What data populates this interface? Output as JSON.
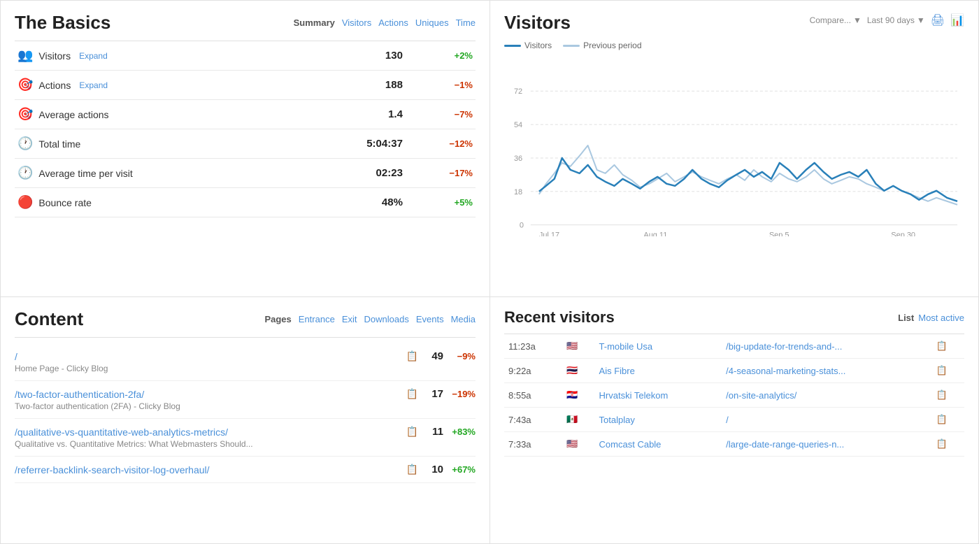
{
  "basics": {
    "title": "The Basics",
    "tabs": [
      {
        "label": "Summary",
        "active": true
      },
      {
        "label": "Visitors"
      },
      {
        "label": "Actions"
      },
      {
        "label": "Uniques"
      },
      {
        "label": "Time"
      }
    ],
    "metrics": [
      {
        "icon": "👥",
        "label": "Visitors",
        "hasExpand": true,
        "value": "130",
        "change": "+2%",
        "changeType": "pos"
      },
      {
        "icon": "🎯",
        "label": "Actions",
        "hasExpand": true,
        "value": "188",
        "change": "−1%",
        "changeType": "neg"
      },
      {
        "icon": "🎯",
        "label": "Average actions",
        "hasExpand": false,
        "value": "1.4",
        "change": "−7%",
        "changeType": "neg"
      },
      {
        "icon": "🕐",
        "label": "Total time",
        "hasExpand": false,
        "value": "5:04:37",
        "change": "−12%",
        "changeType": "neg"
      },
      {
        "icon": "🕐",
        "label": "Average time per visit",
        "hasExpand": false,
        "value": "02:23",
        "change": "−17%",
        "changeType": "neg"
      },
      {
        "icon": "🔴",
        "label": "Bounce rate",
        "hasExpand": false,
        "value": "48%",
        "change": "+5%",
        "changeType": "pos"
      }
    ]
  },
  "visitors_chart": {
    "title": "Visitors",
    "compare_label": "Compare...",
    "range_label": "Last 90 days",
    "legend": {
      "primary": "Visitors",
      "secondary": "Previous period"
    },
    "x_labels": [
      "Jul 17",
      "Aug 11",
      "Sep 5",
      "Sep 30"
    ],
    "y_labels": [
      "0",
      "18",
      "36",
      "54",
      "72"
    ]
  },
  "content": {
    "title": "Content",
    "tabs": [
      {
        "label": "Pages",
        "active": true
      },
      {
        "label": "Entrance"
      },
      {
        "label": "Exit"
      },
      {
        "label": "Downloads"
      },
      {
        "label": "Events"
      },
      {
        "label": "Media"
      }
    ],
    "items": [
      {
        "url": "/",
        "subtitle": "Home Page - Clicky Blog",
        "count": "49",
        "change": "−9%",
        "changeType": "neg"
      },
      {
        "url": "/two-factor-authentication-2fa/",
        "subtitle": "Two-factor authentication (2FA) - Clicky Blog",
        "count": "17",
        "change": "−19%",
        "changeType": "neg"
      },
      {
        "url": "/qualitative-vs-quantitative-web-analytics-metrics/",
        "subtitle": "Qualitative vs. Quantitative Metrics: What Webmasters Should...",
        "count": "11",
        "change": "+83%",
        "changeType": "pos"
      },
      {
        "url": "/referrer-backlink-search-visitor-log-overhaul/",
        "subtitle": "",
        "count": "10",
        "change": "+67%",
        "changeType": "pos"
      }
    ]
  },
  "recent_visitors": {
    "title": "Recent visitors",
    "tabs": [
      {
        "label": "List",
        "active": true
      },
      {
        "label": "Most active"
      }
    ],
    "visitors": [
      {
        "time": "11:23a",
        "flag": "🇺🇸",
        "name": "T-mobile Usa",
        "page": "/big-update-for-trends-and-..."
      },
      {
        "time": "9:22a",
        "flag": "🇹🇭",
        "name": "Ais Fibre",
        "page": "/4-seasonal-marketing-stats..."
      },
      {
        "time": "8:55a",
        "flag": "🇭🇷",
        "name": "Hrvatski Telekom",
        "page": "/on-site-analytics/"
      },
      {
        "time": "7:43a",
        "flag": "🇲🇽",
        "name": "Totalplay",
        "page": "/"
      },
      {
        "time": "7:33a",
        "flag": "🇺🇸",
        "name": "Comcast Cable",
        "page": "/large-date-range-queries-n..."
      }
    ]
  },
  "icons": {
    "expand_label": "Expand",
    "page_icon": "📋",
    "external_icon": "↗"
  }
}
